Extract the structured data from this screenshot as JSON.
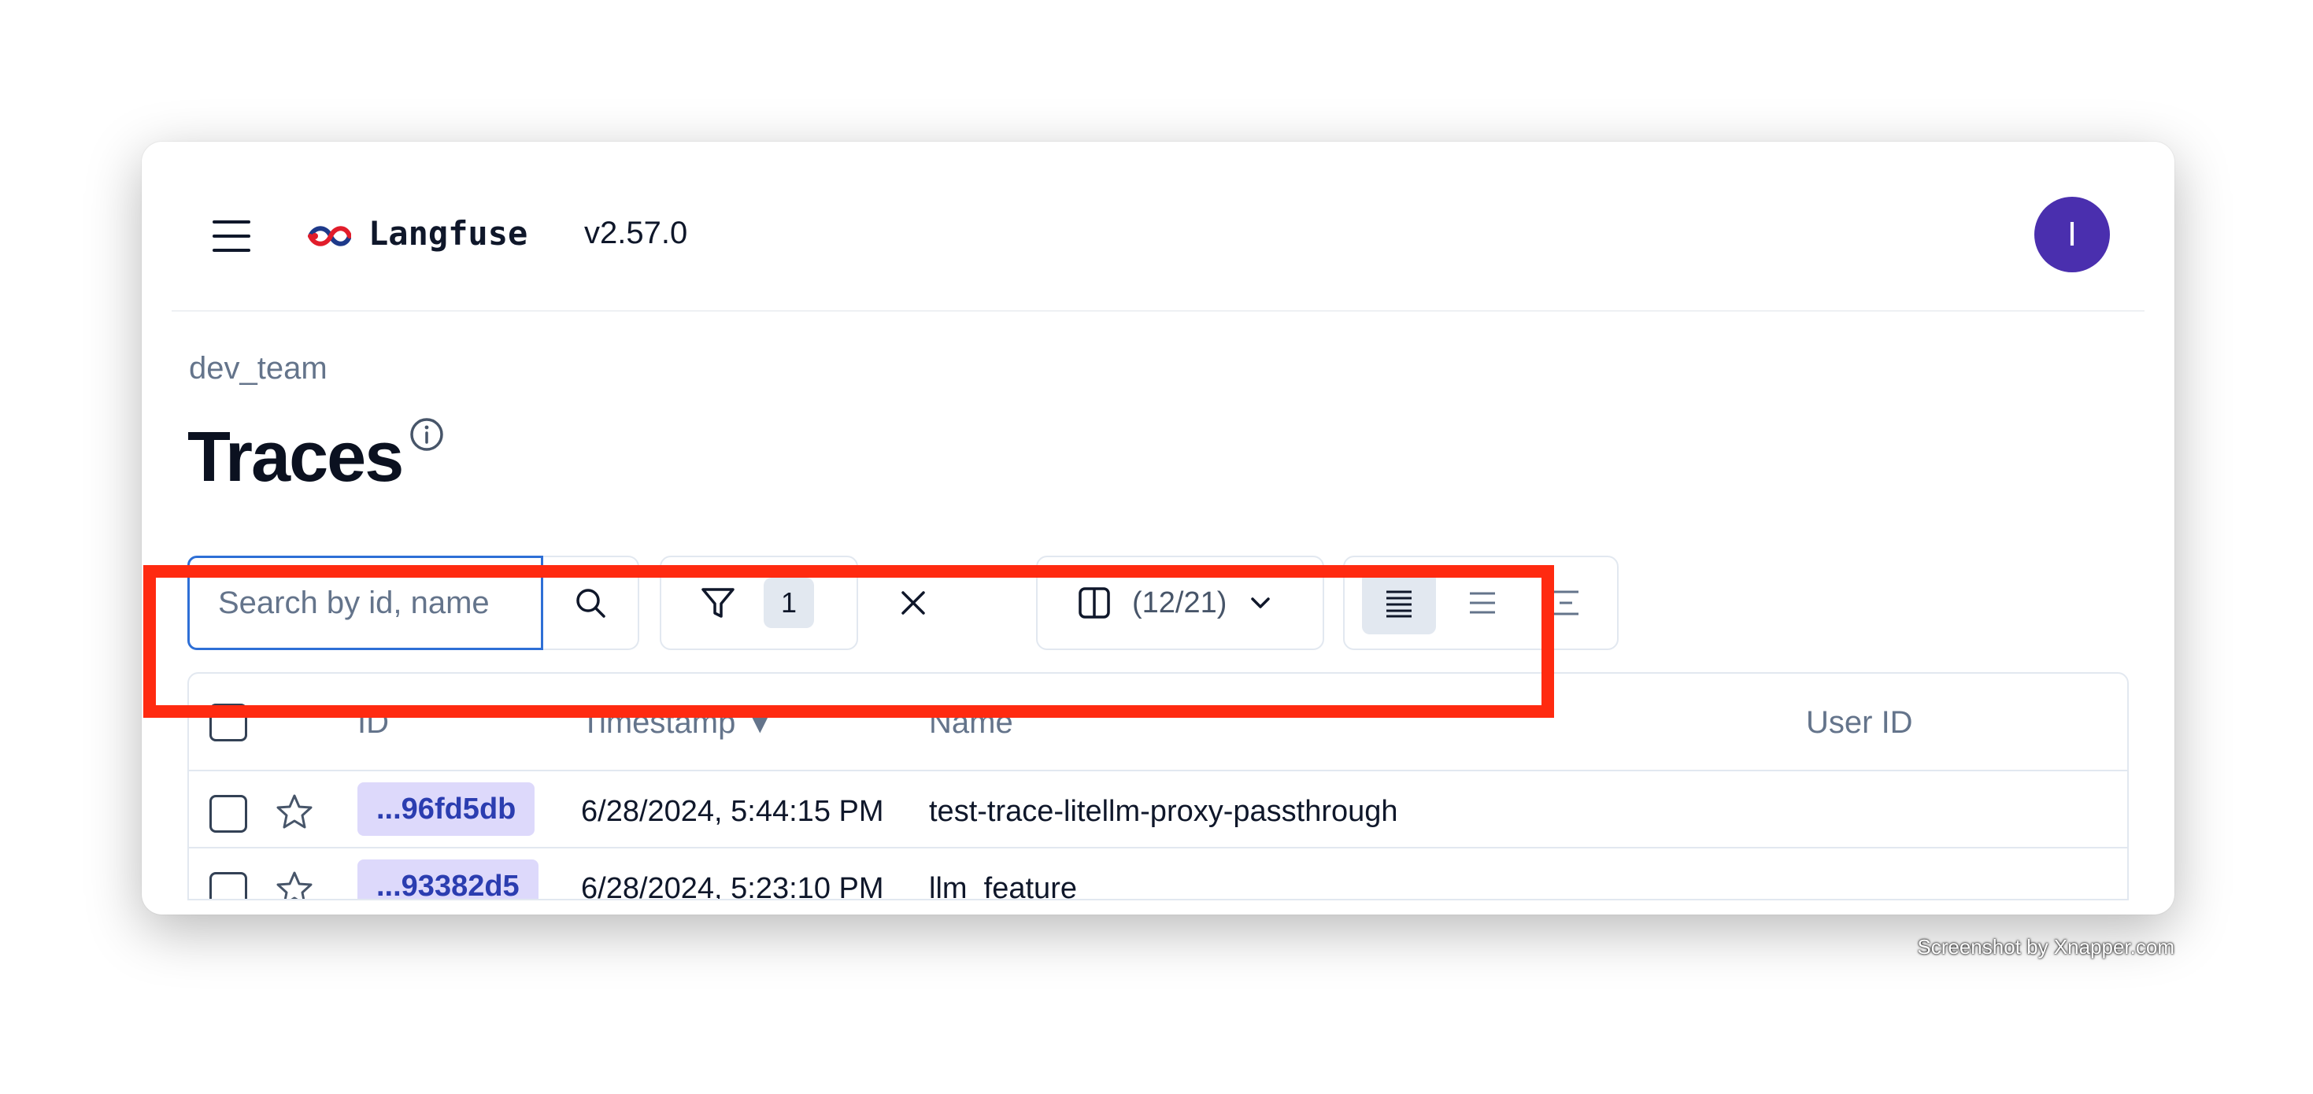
{
  "header": {
    "brand": "Langfuse",
    "version": "v2.57.0",
    "avatar_initial": "I"
  },
  "breadcrumb": {
    "project": "dev_team"
  },
  "page": {
    "title": "Traces"
  },
  "toolbar": {
    "search_placeholder": "Search by id, name",
    "filter_count": "1",
    "columns_label": "(12/21)"
  },
  "table": {
    "headers": {
      "id": "ID",
      "timestamp": "Timestamp ▼",
      "name": "Name",
      "user_id": "User ID"
    },
    "rows": [
      {
        "id": "...96fd5db",
        "timestamp": "6/28/2024, 5:44:15 PM",
        "name": "test-trace-litellm-proxy-passthrough",
        "user_id": ""
      },
      {
        "id": "...93382d5",
        "timestamp": "6/28/2024, 5:23:10 PM",
        "name": "llm_feature",
        "user_id": ""
      }
    ]
  },
  "colors": {
    "accent": "#2e6fd6",
    "avatar": "#4a2fae",
    "id_chip_bg": "#ddd9fb",
    "id_chip_text": "#2b3db0",
    "highlight": "#ff2a10"
  },
  "watermark": "Screenshot by Xnapper.com"
}
